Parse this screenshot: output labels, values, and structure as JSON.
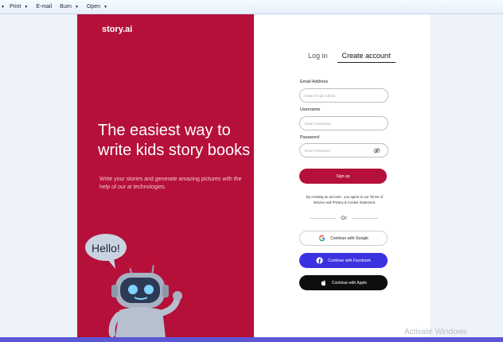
{
  "toolbar": {
    "first_caret": "▼",
    "print": "Print",
    "email": "E-mail",
    "burn": "Burn",
    "open": "Open"
  },
  "brand": {
    "logo": "story.ai",
    "headline": "The easiest way to write kids story books",
    "subline": "Write your stories and generate amazing pictures with the help of our ai technologies.",
    "bubble_text": "Hello!"
  },
  "form": {
    "tab_login": "Log in",
    "tab_create": "Create account",
    "email_label": "Email Address",
    "email_placeholder": "Enter Email Adress",
    "username_label": "Username",
    "username_placeholder": "Enter Username",
    "password_label": "Password",
    "password_placeholder": "Enter Password",
    "signup_button": "Sign up",
    "terms": "By creating an account , you agree to our Terms of Service and Privacy & Cookie Statement.",
    "or": "Or",
    "google": "Continue with Google",
    "facebook": "Continue with Facebook",
    "apple": "Continue with Apple"
  },
  "watermark": "Activate Windows",
  "colors": {
    "brand_red": "#b5103a",
    "facebook_blue": "#3a32e0",
    "apple_black": "#0e0e0e"
  },
  "icons": [
    "chevron-down-icon",
    "eye-off-icon",
    "google-icon",
    "facebook-icon",
    "apple-icon",
    "robot-illustration"
  ]
}
